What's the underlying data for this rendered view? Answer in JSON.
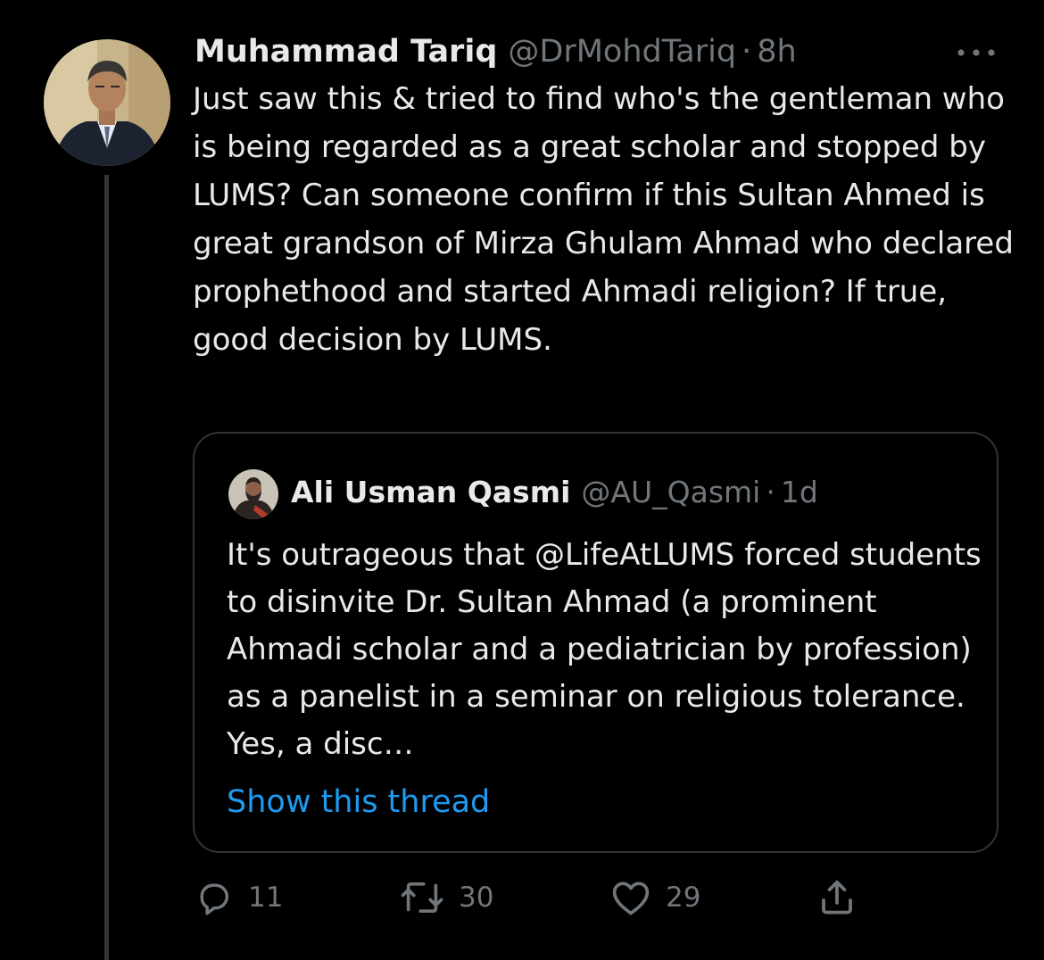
{
  "tweet": {
    "author": {
      "display_name": "Muhammad Tariq",
      "handle": "@DrMohdTariq"
    },
    "separator": "·",
    "time": "8h",
    "text": "Just saw this & tried to find who's the gentleman who is being regarded as a great scholar and stopped by LUMS? Can someone confirm if this Sultan Ahmed is great grandson of Mirza Ghulam Ahmad who declared prophethood and started Ahmadi religion? If true, good decision by LUMS."
  },
  "quoted_tweet": {
    "author": {
      "display_name": "Ali Usman Qasmi",
      "handle": "@AU_Qasmi"
    },
    "separator": "·",
    "time": "1d",
    "text": "It's outrageous that @LifeAtLUMS forced students to disinvite Dr. Sultan Ahmad (a prominent Ahmadi scholar and a pediatrician by profession) as a panelist in a seminar on religious tolerance. Yes, a disc…",
    "show_thread_label": "Show this thread"
  },
  "actions": {
    "reply": {
      "icon": "reply-icon",
      "count": "11"
    },
    "retweet": {
      "icon": "retweet-icon",
      "count": "30"
    },
    "like": {
      "icon": "heart-icon",
      "count": "29"
    },
    "share": {
      "icon": "share-icon"
    }
  },
  "more_icon": "more-horizontal-icon",
  "colors": {
    "background": "#000000",
    "text_primary": "#e7e9ea",
    "text_secondary": "#71767b",
    "link": "#1d9bf0",
    "border": "#2f3336",
    "thread_line": "#333639"
  }
}
